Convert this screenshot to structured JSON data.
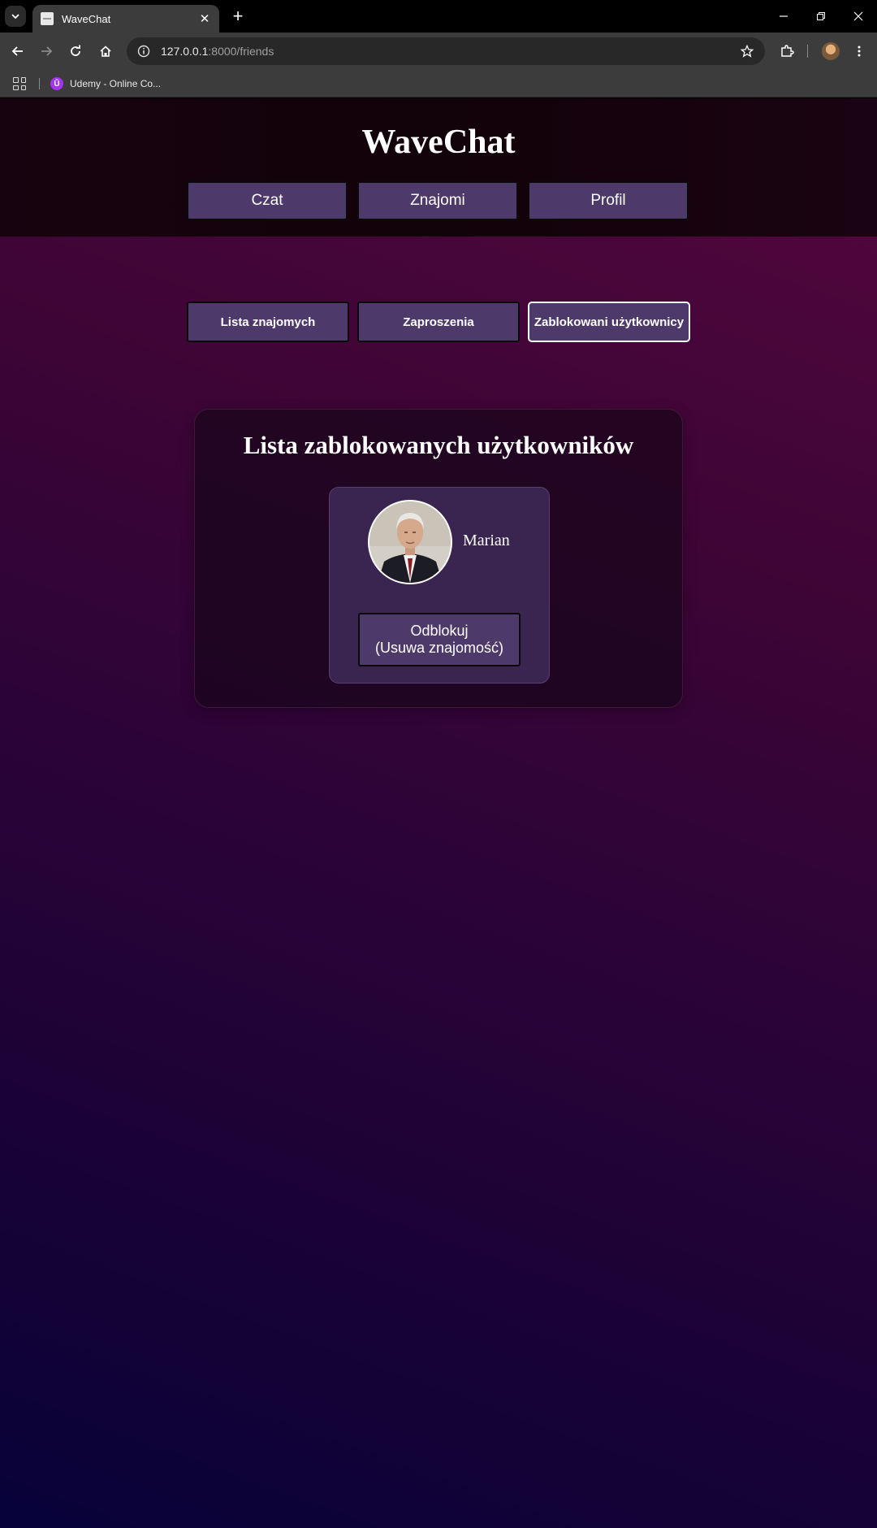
{
  "browser": {
    "tab_title": "WaveChat",
    "url_host": "127.0.0.1",
    "url_path": ":8000/friends",
    "bookmark_label": "Udemy - Online Co...",
    "bookmark_icon_letter": "Ū"
  },
  "site": {
    "title": "WaveChat",
    "nav": [
      "Czat",
      "Znajomi",
      "Profil"
    ]
  },
  "friends_nav": {
    "tabs": [
      "Lista znajomych",
      "Zaproszenia",
      "Zablokowani użytkownicy"
    ],
    "active": "Zablokowani użytkownicy"
  },
  "blocked": {
    "heading": "Lista zablokowanych użytkowników",
    "users": [
      {
        "name": "Marian",
        "unblock_line1": "Odblokuj",
        "unblock_line2": "(Usuwa znajomość)"
      }
    ]
  },
  "colors": {
    "button_bg": "#4e3a6a",
    "header_bg": "#120209",
    "page_gradient_top": "#54063e",
    "page_gradient_bottom": "#07023a"
  }
}
